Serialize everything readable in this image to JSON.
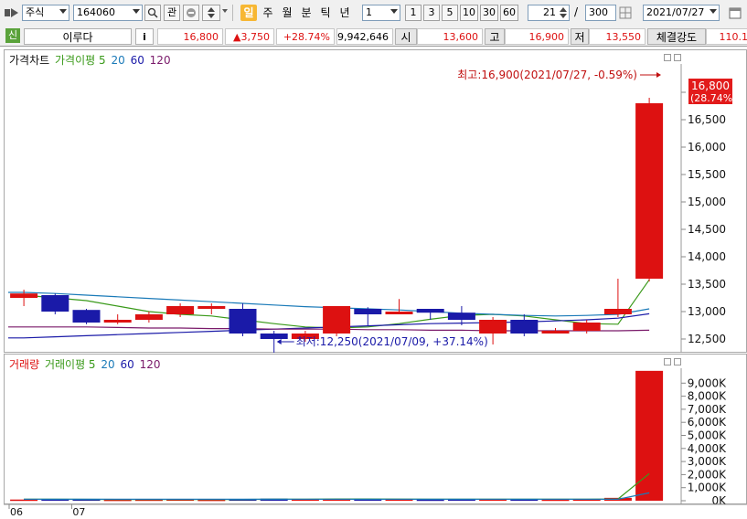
{
  "toolbar": {
    "type_select": "주식",
    "code_input": "164060",
    "gwan_label": "관",
    "periods": [
      "일",
      "주",
      "월",
      "분",
      "틱",
      "년"
    ],
    "active_period": "일",
    "unit_select": "1",
    "quick_units": [
      "1",
      "3",
      "5",
      "10",
      "30",
      "60"
    ],
    "count_input": "21",
    "total_count": "300",
    "date_input": "2021/07/27"
  },
  "quote": {
    "market_badge": "신",
    "name": "이루다",
    "info_button": "i",
    "price": "16,800",
    "change": "▲3,750",
    "change_pct": "+28.74%",
    "volume": "9,942,646",
    "open_label": "시",
    "open": "13,600",
    "high_label": "고",
    "high": "16,900",
    "low_label": "저",
    "low": "13,550",
    "strength_label": "체결강도",
    "strength": "110.1"
  },
  "colors": {
    "up": "#dd1111",
    "down": "#1a1aa8",
    "ma5": "#3a9a1a",
    "ma20": "#1a7ab8",
    "ma60": "#1a1aa8",
    "ma120": "#7a1a6a"
  },
  "chart_data": [
    {
      "type": "candlestick",
      "legend": {
        "title": "가격차트",
        "items": [
          "가격이평 5",
          "20",
          "60",
          "120"
        ]
      },
      "ylim": [
        12300,
        17300
      ],
      "yticks": [
        "12,500",
        "13,000",
        "13,500",
        "14,000",
        "14,500",
        "15,000",
        "15,500",
        "16,000",
        "16,500",
        "17,000"
      ],
      "xticks": [
        {
          "index": 0,
          "label": "06"
        },
        {
          "index": 2,
          "label": "07"
        }
      ],
      "candles": [
        {
          "o": 13250,
          "h": 13400,
          "l": 13100,
          "c": 13330
        },
        {
          "o": 13300,
          "h": 13330,
          "l": 12950,
          "c": 13000
        },
        {
          "o": 13030,
          "h": 13050,
          "l": 12770,
          "c": 12800
        },
        {
          "o": 12800,
          "h": 12950,
          "l": 12770,
          "c": 12850
        },
        {
          "o": 12850,
          "h": 13000,
          "l": 12800,
          "c": 12950
        },
        {
          "o": 12950,
          "h": 13150,
          "l": 12900,
          "c": 13100
        },
        {
          "o": 13050,
          "h": 13150,
          "l": 12950,
          "c": 13100
        },
        {
          "o": 13050,
          "h": 13150,
          "l": 12550,
          "c": 12600
        },
        {
          "o": 12600,
          "h": 12650,
          "l": 12250,
          "c": 12500
        },
        {
          "o": 12500,
          "h": 12650,
          "l": 12450,
          "c": 12600
        },
        {
          "o": 12600,
          "h": 13100,
          "l": 12550,
          "c": 13100
        },
        {
          "o": 13050,
          "h": 13080,
          "l": 12750,
          "c": 12950
        },
        {
          "o": 12950,
          "h": 13230,
          "l": 12950,
          "c": 13000
        },
        {
          "o": 13050,
          "h": 13050,
          "l": 12850,
          "c": 12980
        },
        {
          "o": 12980,
          "h": 13100,
          "l": 12750,
          "c": 12850
        },
        {
          "o": 12600,
          "h": 12900,
          "l": 12400,
          "c": 12850
        },
        {
          "o": 12850,
          "h": 12950,
          "l": 12550,
          "c": 12600
        },
        {
          "o": 12600,
          "h": 12700,
          "l": 12600,
          "c": 12650
        },
        {
          "o": 12650,
          "h": 12850,
          "l": 12600,
          "c": 12800
        },
        {
          "o": 12950,
          "h": 13600,
          "l": 12900,
          "c": 13050
        },
        {
          "o": 13600,
          "h": 16900,
          "l": 13550,
          "c": 16800
        }
      ],
      "moving_averages": [
        {
          "name": "5",
          "values": [
            13300,
            13250,
            13200,
            13100,
            13000,
            12950,
            12920,
            12850,
            12780,
            12720,
            12700,
            12720,
            12780,
            12860,
            12930,
            12950,
            12920,
            12850,
            12780,
            12770,
            13580
          ]
        },
        {
          "name": "20",
          "values": [
            13350,
            13330,
            13300,
            13270,
            13240,
            13210,
            13180,
            13150,
            13120,
            13090,
            13070,
            13050,
            13030,
            13000,
            12970,
            12950,
            12930,
            12920,
            12930,
            12950,
            13050
          ]
        },
        {
          "name": "60",
          "values": [
            12520,
            12540,
            12560,
            12580,
            12600,
            12620,
            12640,
            12660,
            12680,
            12700,
            12720,
            12740,
            12760,
            12780,
            12790,
            12800,
            12810,
            12830,
            12850,
            12880,
            12960
          ]
        },
        {
          "name": "120",
          "values": [
            12720,
            12720,
            12720,
            12710,
            12700,
            12700,
            12690,
            12690,
            12680,
            12680,
            12680,
            12670,
            12670,
            12660,
            12660,
            12650,
            12650,
            12650,
            12650,
            12650,
            12660
          ]
        }
      ],
      "annotations": [
        {
          "text": "최고:16,900(2021/07/27, -0.59%)",
          "index": 20,
          "value": 16900
        },
        {
          "text": "최저:12,250(2021/07/09, +37.14%)",
          "index": 8,
          "value": 12250
        }
      ],
      "last_price_label": [
        "16,800",
        "(28.74%)"
      ]
    },
    {
      "type": "bar",
      "legend": {
        "title": "거래량",
        "items": [
          "거래이평 5",
          "20",
          "60",
          "120"
        ]
      },
      "ylim": [
        0,
        10000
      ],
      "unit": "K",
      "yticks": [
        "0K",
        "1,000K",
        "2,000K",
        "3,000K",
        "4,000K",
        "5,000K",
        "6,000K",
        "7,000K",
        "8,000K",
        "9,000K"
      ],
      "values": [
        90,
        110,
        120,
        80,
        90,
        100,
        80,
        140,
        160,
        130,
        120,
        110,
        100,
        90,
        130,
        140,
        100,
        90,
        100,
        220,
        9940
      ],
      "moving_averages": [
        {
          "name": "5",
          "values": [
            120,
            110,
            105,
            100,
            98,
            100,
            95,
            98,
            115,
            120,
            130,
            130,
            125,
            115,
            110,
            115,
            115,
            110,
            110,
            130,
            2080
          ]
        },
        {
          "name": "20",
          "values": [
            110,
            110,
            110,
            110,
            110,
            110,
            110,
            110,
            110,
            110,
            110,
            110,
            110,
            110,
            110,
            110,
            110,
            110,
            110,
            115,
            600
          ]
        }
      ]
    }
  ]
}
